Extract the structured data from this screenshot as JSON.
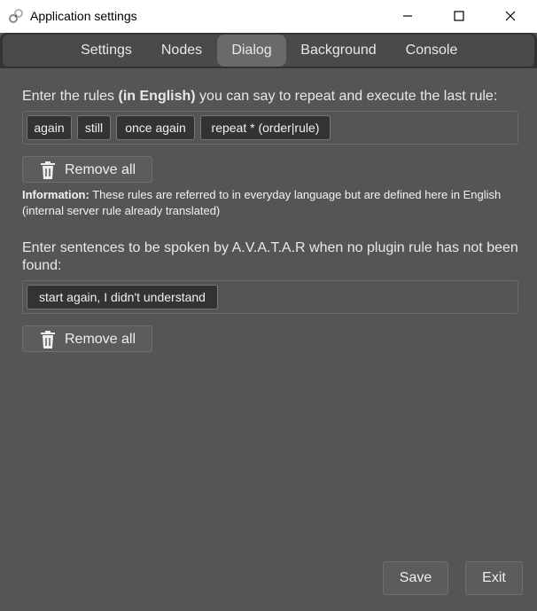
{
  "window": {
    "title": "Application settings",
    "icon": "gear-link-icon"
  },
  "tabs": [
    {
      "label": "Settings",
      "active": false
    },
    {
      "label": "Nodes",
      "active": false
    },
    {
      "label": "Dialog",
      "active": true
    },
    {
      "label": "Background",
      "active": false
    },
    {
      "label": "Console",
      "active": false
    }
  ],
  "rules_section": {
    "prompt_before": "Enter the rules ",
    "prompt_bold": "(in English)",
    "prompt_after": " you can say to repeat and execute the last rule:",
    "chips": [
      "again",
      "still",
      "once again",
      "repeat * (order|rule)"
    ],
    "remove_label": "Remove all",
    "info_bold": "Information:",
    "info_text": " These rules are referred to in everyday language but are defined here in English (internal server rule already translated)"
  },
  "sentences_section": {
    "prompt": "Enter sentences to be spoken by A.V.A.T.A.R when no plugin rule has not been found:",
    "chips": [
      "start again, I didn't understand"
    ],
    "remove_label": "Remove all"
  },
  "footer": {
    "save_label": "Save",
    "exit_label": "Exit"
  }
}
